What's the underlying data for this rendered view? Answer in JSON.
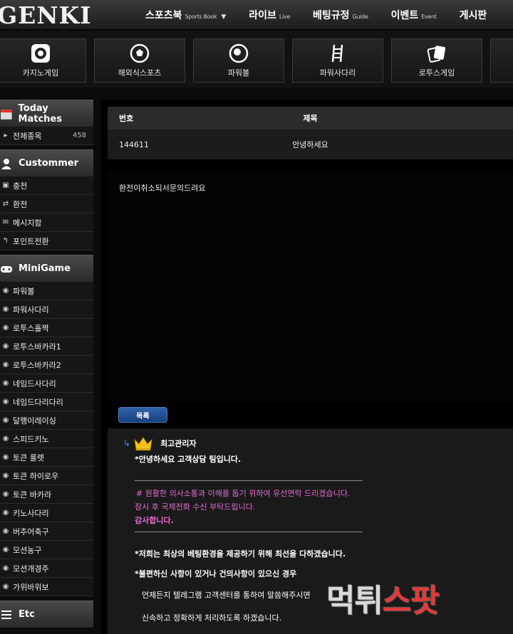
{
  "brand": {
    "logo": "GENKI"
  },
  "nav": [
    {
      "label": "스포츠북",
      "sub": "Sports Book",
      "caret": true
    },
    {
      "label": "라이브",
      "sub": "Live",
      "caret": false
    },
    {
      "label": "베팅규정",
      "sub": "Guide",
      "caret": false
    },
    {
      "label": "이벤트",
      "sub": "Event",
      "caret": false
    },
    {
      "label": "게시판",
      "sub": "",
      "caret": false
    }
  ],
  "games": [
    {
      "label": "카지노게임",
      "icon": "casino-chip-icon"
    },
    {
      "label": "해외식스포츠",
      "icon": "soccer-ball-icon"
    },
    {
      "label": "파워볼",
      "icon": "powerball-icon"
    },
    {
      "label": "파워사다리",
      "icon": "ladder-icon"
    },
    {
      "label": "로투스게임",
      "icon": "playing-cards-icon"
    }
  ],
  "sidebar": {
    "today": {
      "title": "Today Matches",
      "items": [
        {
          "label": "전체종목",
          "count": "458"
        }
      ]
    },
    "customer": {
      "title": "Custommer",
      "items": [
        {
          "label": "충전",
          "icon": "wallet-icon"
        },
        {
          "label": "환전",
          "icon": "exchange-icon"
        },
        {
          "label": "메시지함",
          "icon": "mail-icon"
        },
        {
          "label": "포인트전환",
          "icon": "reply-icon"
        }
      ]
    },
    "minigame": {
      "title": "MiniGame",
      "items": [
        "파워볼",
        "파워사다리",
        "로투스홀짝",
        "로투스바카라1",
        "로투스바카라2",
        "네임드사다리",
        "네임드다리다리",
        "달팽이레이싱",
        "스피드키노",
        "토큰 룰렛",
        "토큰 하이로우",
        "토큰 바카라",
        "키노사다리",
        "버추어축구",
        "모션농구",
        "모션개경주",
        "가위바위보"
      ]
    },
    "etc": {
      "title": "Etc"
    }
  },
  "board": {
    "col_no": "번호",
    "col_title": "제목",
    "row": {
      "no": "144611",
      "title": "안녕하세요"
    },
    "content": "환전이취소되서문의드려요",
    "list_button": "목록"
  },
  "reply": {
    "author": "최고관리자",
    "greeting": "*안녕하세요 고객상담 팀입니다.",
    "notice1": "# 원활한 의사소통과 이해를 돕기 위하여 유선연락 드리겠습니다.",
    "notice2": "잠시 후 국제전화 수신 부탁드립니다.",
    "thanks": "감사합니다.",
    "p1": "*저희는 최상의 베팅환경을 제공하기 위해 최선을 다하겠습니다.",
    "p2": "*불편하신 사항이 있거나 건의사항이 있으신 경우",
    "p3": "언제든지 텔레그램 고객센터를 통하여 말씀해주시면",
    "p4": "신속하고 정확하게 처리하도록 하겠습니다."
  },
  "watermark": {
    "text1": "먹튀",
    "text2": "스팟"
  },
  "colors": {
    "accent_blue": "#2f64ad",
    "pink": "#e36fd1",
    "watermark_red": "#e23a3a"
  }
}
